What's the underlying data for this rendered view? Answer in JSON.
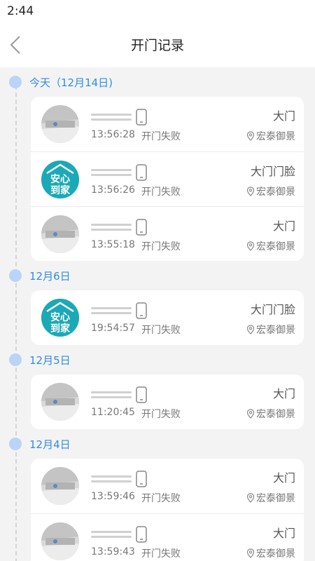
{
  "status_bar": {
    "time": "2:44"
  },
  "header": {
    "title": "开门记录"
  },
  "groups": [
    {
      "date": "今天（12月14日)",
      "records": [
        {
          "avatar": "photo",
          "time": "13:56:28",
          "status": "开门失败",
          "door": "大门",
          "location": "宏泰御景"
        },
        {
          "avatar": "logo",
          "time": "13:56:26",
          "status": "开门失败",
          "door": "大门门脸",
          "location": "宏泰御景"
        },
        {
          "avatar": "photo",
          "time": "13:55:18",
          "status": "开门失败",
          "door": "大门",
          "location": "宏泰御景"
        }
      ]
    },
    {
      "date": "12月6日",
      "records": [
        {
          "avatar": "logo",
          "time": "19:54:57",
          "status": "开门失败",
          "door": "大门门脸",
          "location": "宏泰御景"
        }
      ]
    },
    {
      "date": "12月5日",
      "records": [
        {
          "avatar": "photo",
          "time": "11:20:45",
          "status": "开门失败",
          "door": "大门",
          "location": "宏泰御景"
        }
      ]
    },
    {
      "date": "12月4日",
      "records": [
        {
          "avatar": "photo",
          "time": "13:59:46",
          "status": "开门失败",
          "door": "大门",
          "location": "宏泰御景"
        },
        {
          "avatar": "photo",
          "time": "13:59:43",
          "status": "开门失败",
          "door": "大门",
          "location": "宏泰御景"
        }
      ]
    }
  ],
  "logo_text": {
    "line1": "安心",
    "line2": "到家"
  },
  "colors": {
    "accent": "#2f8de4",
    "dot": "#b9d4f6",
    "logo_bg": "#1ba9b7"
  }
}
